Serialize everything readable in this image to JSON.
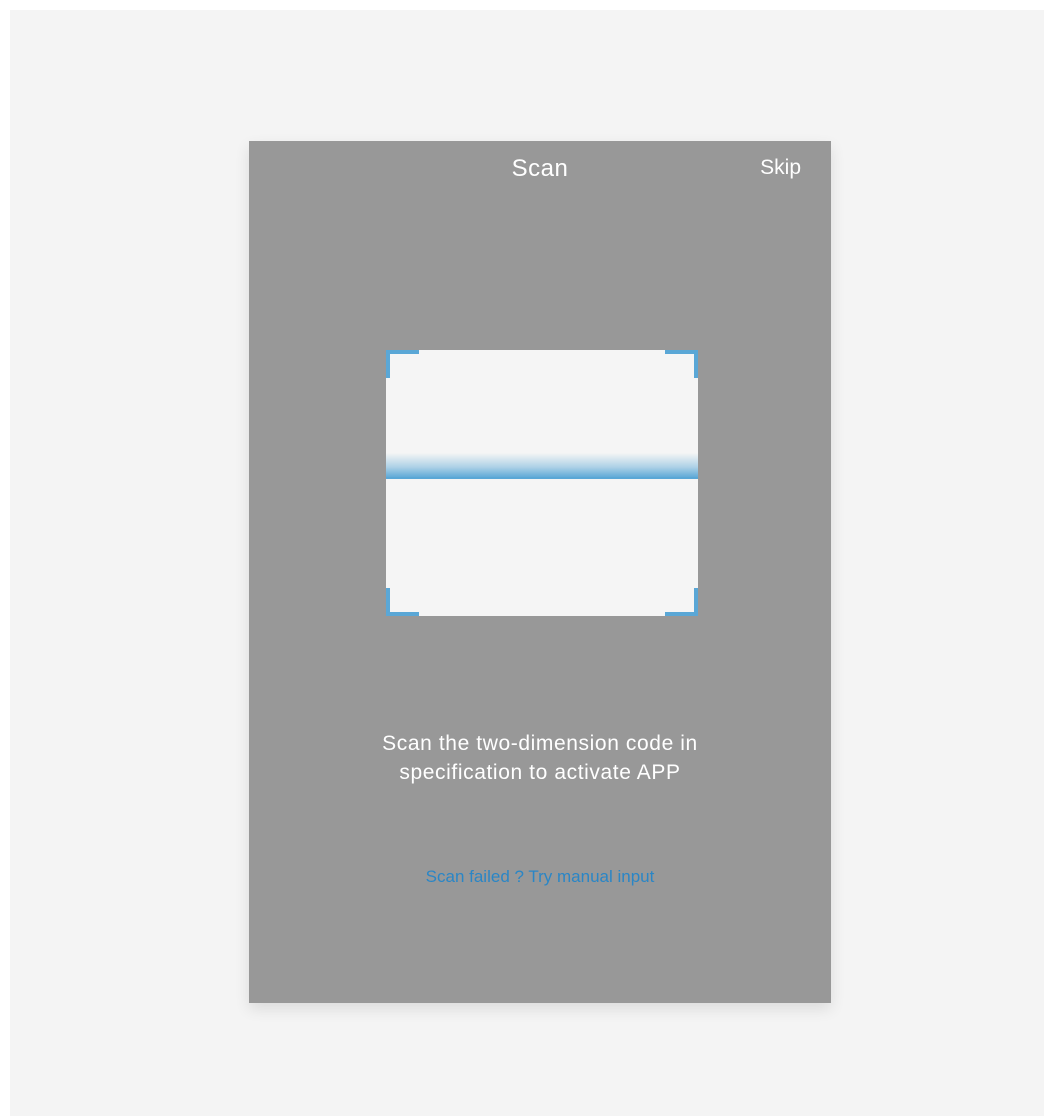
{
  "header": {
    "title": "Scan",
    "skip_label": "Skip"
  },
  "scanner": {
    "frame_icon": "qr-scan-frame-icon",
    "accent_color": "#5aa7d6"
  },
  "instruction": {
    "line1": "Scan the two-dimension code in",
    "line2": "specification to activate APP"
  },
  "manual_input": {
    "label": "Scan failed ? Try manual input",
    "color": "#2a86c6"
  }
}
